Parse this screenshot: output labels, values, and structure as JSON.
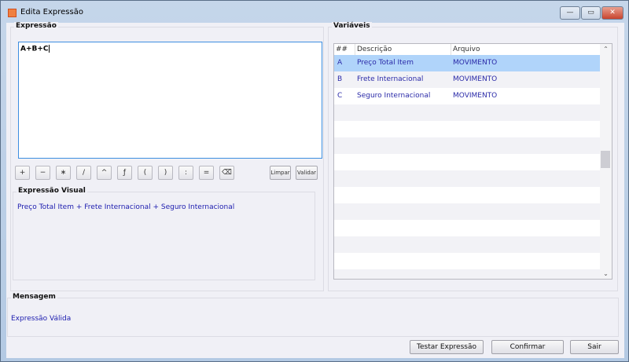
{
  "window": {
    "title": "Edita Expressão",
    "minimize": "—",
    "maximize": "▭",
    "close": "✕"
  },
  "expression": {
    "label": "Expressão",
    "value": "A+B+C"
  },
  "operators": [
    "+",
    "−",
    "∗",
    "/",
    "^",
    "ƒ",
    "(",
    ")",
    ":",
    "=",
    "⌫"
  ],
  "buttons": {
    "clear": "Limpar",
    "validate": "Validar",
    "test": "Testar Expressão",
    "confirm": "Confirmar",
    "exit": "Sair"
  },
  "visual": {
    "label": "Expressão Visual",
    "value": "Preço Total Item + Frete Internacional + Seguro Internacional"
  },
  "variables": {
    "label": "Variáveis",
    "columns": [
      "##",
      "Descrição",
      "Arquivo"
    ],
    "rows": [
      {
        "id": "A",
        "desc": "Preço Total Item",
        "file": "MOVIMENTO"
      },
      {
        "id": "B",
        "desc": "Frete Internacional",
        "file": "MOVIMENTO"
      },
      {
        "id": "C",
        "desc": "Seguro Internacional",
        "file": "MOVIMENTO"
      }
    ]
  },
  "message": {
    "label": "Mensagem",
    "value": "Expressão Válida"
  }
}
